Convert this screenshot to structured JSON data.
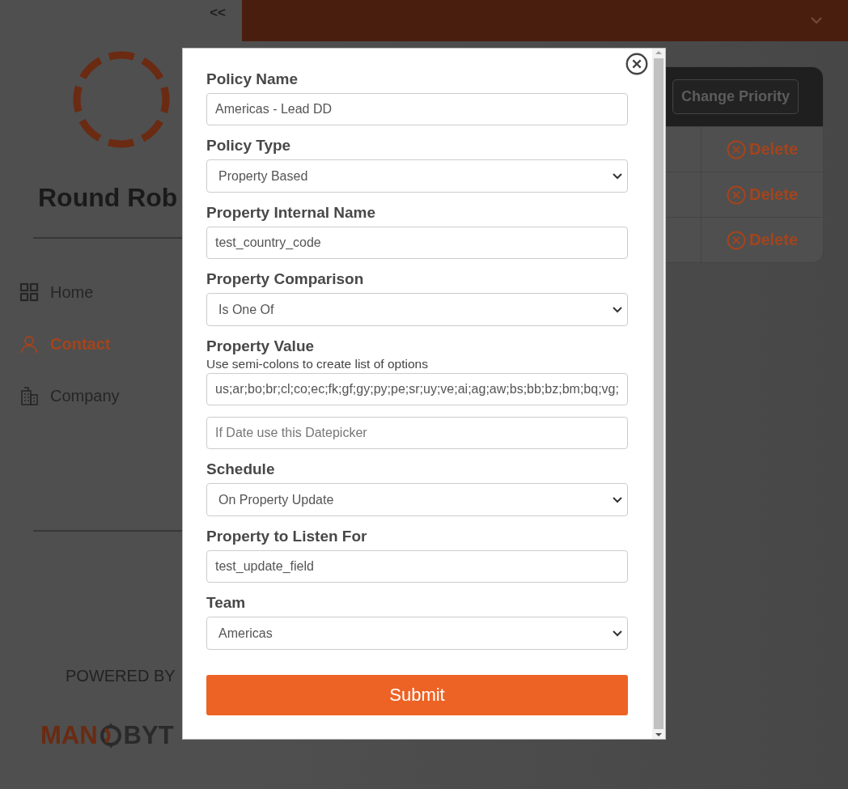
{
  "sidebar": {
    "collapse": "<<",
    "title": "Round Rob",
    "nav": [
      {
        "label": "Home",
        "selected": false
      },
      {
        "label": "Contact",
        "selected": true
      },
      {
        "label": "Company",
        "selected": false
      }
    ],
    "powered_by": "POWERED BY",
    "logo": {
      "left": "MAN",
      "right": "BYT"
    }
  },
  "table": {
    "header_button": "Change Priority",
    "rows": [
      {
        "action": "Delete"
      },
      {
        "action": "Delete"
      },
      {
        "action": "Delete"
      }
    ]
  },
  "modal": {
    "fields": [
      {
        "kind": "input",
        "label": "Policy Name",
        "value": "Americas - Lead DD"
      },
      {
        "kind": "select",
        "label": "Policy Type",
        "value": "Property Based"
      },
      {
        "kind": "input",
        "label": "Property Internal Name",
        "value": "test_country_code"
      },
      {
        "kind": "select",
        "label": "Property Comparison",
        "value": "Is One Of"
      },
      {
        "kind": "input",
        "label": "Property Value",
        "hint": "Use semi-colons to create list of options",
        "value": "us;ar;bo;br;cl;co;ec;fk;gf;gy;py;pe;sr;uy;ve;ai;ag;aw;bs;bb;bz;bm;bq;vg;"
      },
      {
        "kind": "input",
        "placeholder": "If Date use this Datepicker"
      },
      {
        "kind": "select",
        "label": "Schedule",
        "value": "On Property Update"
      },
      {
        "kind": "input",
        "label": "Property to Listen For",
        "value": "test_update_field"
      },
      {
        "kind": "select",
        "label": "Team",
        "value": "Americas"
      }
    ],
    "submit": "Submit"
  }
}
